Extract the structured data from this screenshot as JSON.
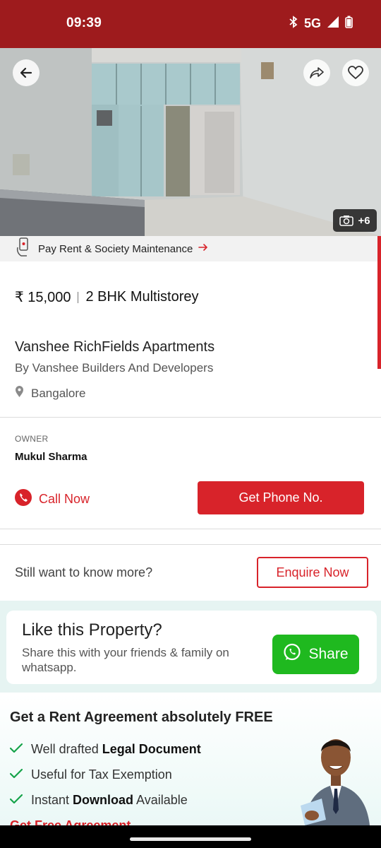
{
  "status_bar": {
    "time": "09:39",
    "network": "5G"
  },
  "hero": {
    "photo_count": "+6"
  },
  "pay_bar": {
    "label": "Pay Rent & Society Maintenance"
  },
  "listing": {
    "price": "₹ 15,000",
    "type": "2 BHK Multistorey",
    "project": "Vanshee RichFields Apartments",
    "builder_prefix": "By",
    "builder_name": "Vanshee Builders And Developers",
    "location": "Bangalore"
  },
  "owner": {
    "label": "OWNER",
    "name": "Mukul Sharma"
  },
  "actions": {
    "call_now": "Call Now",
    "get_phone": "Get Phone No."
  },
  "enquiry": {
    "prompt": "Still want to know more?",
    "button": "Enquire Now"
  },
  "whatsapp_card": {
    "title": "Like this Property?",
    "subtitle": "Share this with your friends & family on whatsapp.",
    "button": "Share"
  },
  "rent_agreement": {
    "title": "Get a Rent Agreement absolutely FREE",
    "features": [
      {
        "text": "Well drafted ",
        "bold": "Legal Document",
        "after": ""
      },
      {
        "text": "Useful for Tax Exemption",
        "bold": "",
        "after": ""
      },
      {
        "text": "Instant ",
        "bold": "Download",
        "after": " Available"
      }
    ],
    "link": "Get Free Agreement →"
  },
  "colors": {
    "brand_red": "#d8232a",
    "status_bar": "#9e1b1d",
    "whatsapp_green": "#1fb91f"
  }
}
